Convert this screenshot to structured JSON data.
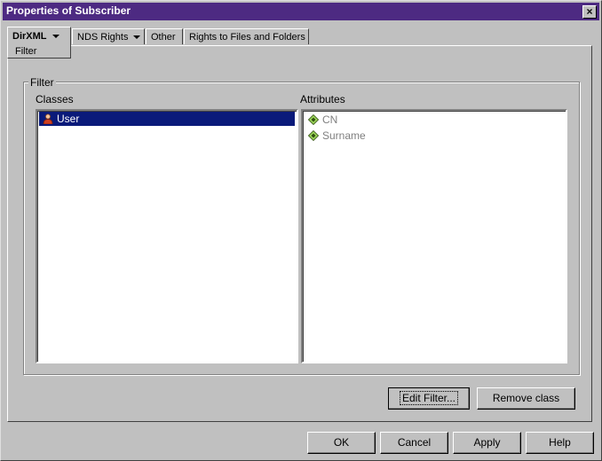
{
  "window": {
    "title": "Properties of Subscriber"
  },
  "tabs": [
    {
      "label": "DirXML",
      "has_menu": true,
      "active": true
    },
    {
      "label": "NDS Rights",
      "has_menu": true,
      "active": false
    },
    {
      "label": "Other",
      "has_menu": false,
      "active": false
    },
    {
      "label": "Rights to Files and Folders",
      "has_menu": false,
      "active": false
    }
  ],
  "subtab": {
    "label": "Filter"
  },
  "filter": {
    "group_label": "Filter",
    "classes_label": "Classes",
    "attributes_label": "Attributes",
    "classes": [
      {
        "label": "User",
        "selected": true,
        "icon": "user-icon"
      }
    ],
    "attributes": [
      {
        "label": "CN",
        "icon": "attribute-diamond-icon"
      },
      {
        "label": "Surname",
        "icon": "attribute-diamond-icon"
      }
    ],
    "edit_filter_label": "Edit Filter...",
    "remove_class_label": "Remove class"
  },
  "footer": {
    "ok_label": "OK",
    "cancel_label": "Cancel",
    "apply_label": "Apply",
    "help_label": "Help"
  },
  "colors": {
    "title_bar": "#4d2a82",
    "selection": "#0a1a7a",
    "face": "#c0c0c0"
  }
}
